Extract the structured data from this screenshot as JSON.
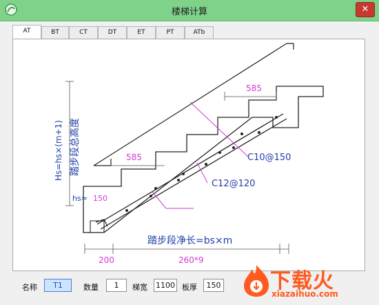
{
  "window": {
    "title": "楼梯计算"
  },
  "tabs": [
    {
      "label": "AT",
      "active": true
    },
    {
      "label": "BT"
    },
    {
      "label": "CT"
    },
    {
      "label": "DT"
    },
    {
      "label": "ET"
    },
    {
      "label": "PT"
    },
    {
      "label": "ATb"
    }
  ],
  "diagram": {
    "height_formula": "Hs=hs×(m+1)",
    "height_label": "踏步段总高度",
    "hs_label": "hs=",
    "hs_value": "150",
    "dim_top": "585",
    "dim_mid": "585",
    "rebar_top": "C10@150",
    "rebar_mid": "C12@120",
    "length_formula": "踏步段净长=bs×m",
    "dim_bottom_left": "200",
    "dim_bottom_mid": "260*9"
  },
  "form": {
    "name_label": "名称",
    "name_value": "T1",
    "qty_label": "数量",
    "qty_value": "1",
    "width_label": "梯宽",
    "width_value": "1100",
    "thick_label": "板厚",
    "thick_value": "150"
  },
  "watermark": {
    "text": "下载火",
    "url": "xiazaihuo.com"
  },
  "colors": {
    "titlebar": "#7ed28a",
    "magenta": "#d23bd2",
    "blue_text": "#1f3fa8",
    "watermark": "#ff5a1f"
  }
}
